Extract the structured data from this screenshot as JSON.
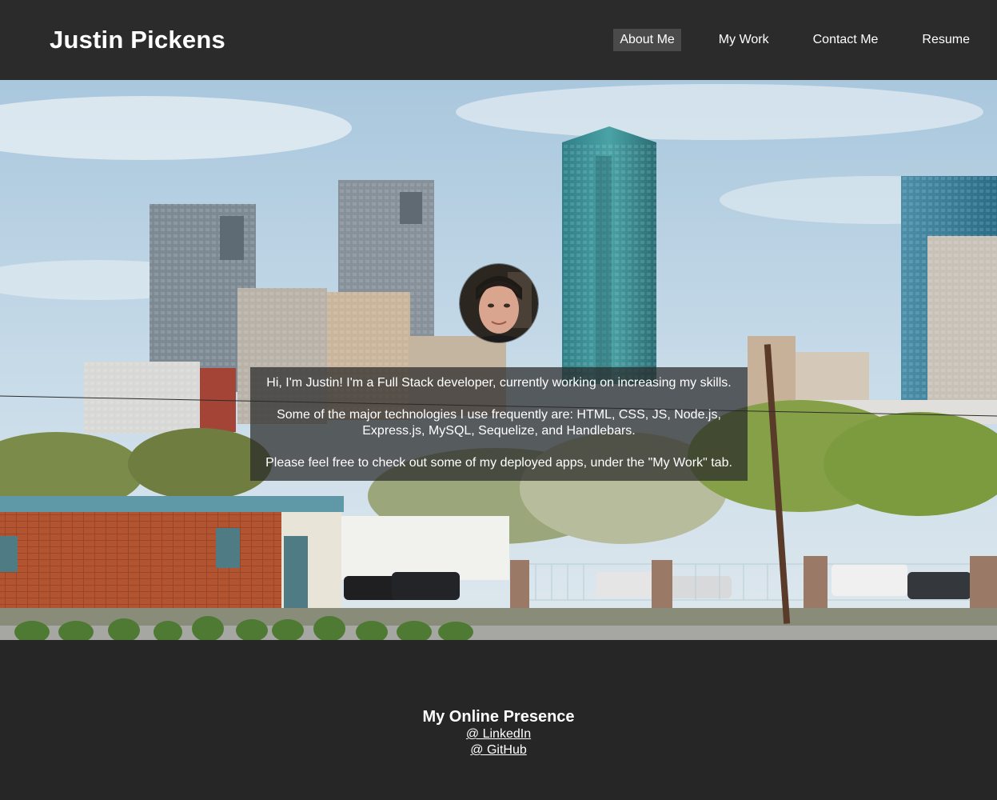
{
  "header": {
    "title": "Justin Pickens",
    "nav": [
      {
        "label": "About Me",
        "active": true
      },
      {
        "label": "My Work",
        "active": false
      },
      {
        "label": "Contact Me",
        "active": false
      },
      {
        "label": "Resume",
        "active": false
      }
    ]
  },
  "hero": {
    "intro": [
      "Hi, I'm Justin! I'm a Full Stack developer, currently working on increasing my skills.",
      "Some of the major technologies I use frequently are: HTML, CSS, JS, Node.js, Express.js, MySQL, Sequelize, and Handlebars.",
      "Please feel free to check out some of my deployed apps, under the \"My Work\" tab."
    ]
  },
  "footer": {
    "heading": "My Online Presence",
    "links": [
      {
        "label": "@ LinkedIn"
      },
      {
        "label": "@ GitHub"
      }
    ]
  },
  "colors": {
    "header_bg": "#2b2b2b",
    "footer_bg": "#262626",
    "active_nav_bg": "#4a4a4a",
    "text": "#ffffff"
  }
}
